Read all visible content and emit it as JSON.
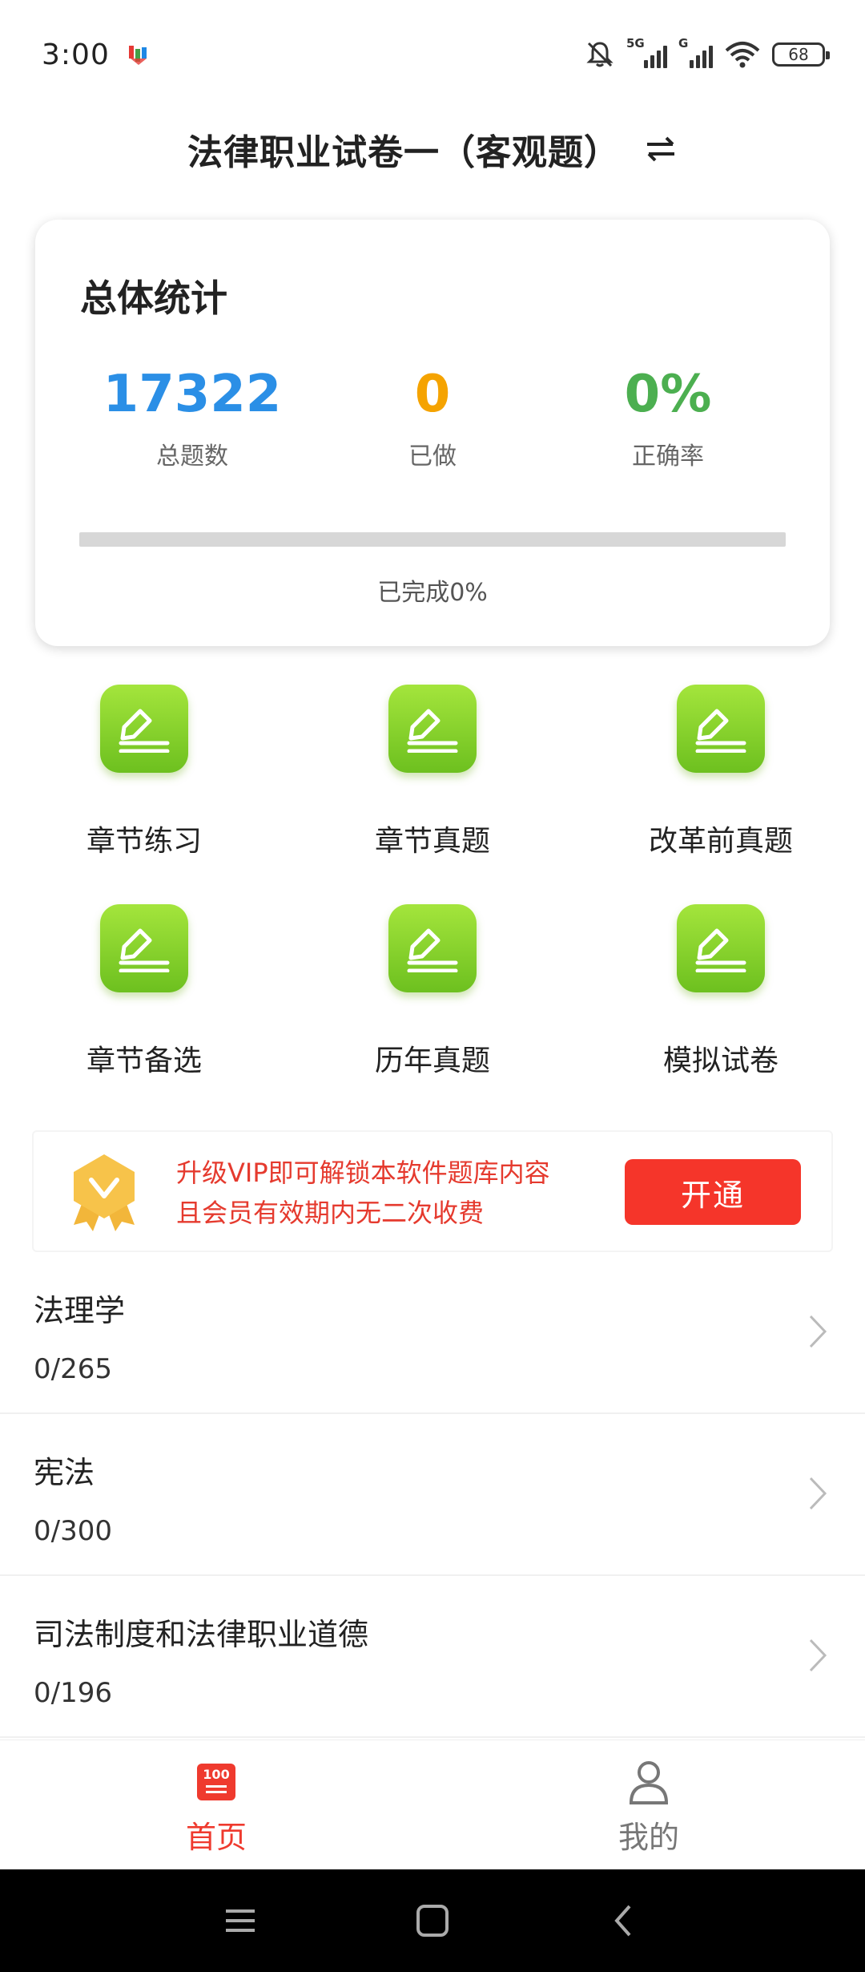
{
  "status_bar": {
    "time": "3:00",
    "signal_1_tag": "5G",
    "signal_2_tag": "G",
    "battery": "68"
  },
  "header": {
    "title": "法律职业试卷一（客观题）",
    "swap_icon": "swap-arrows-icon"
  },
  "stats": {
    "title": "总体统计",
    "total_value": "17322",
    "total_label": "总题数",
    "done_value": "0",
    "done_label": "已做",
    "accuracy_value": "0%",
    "accuracy_label": "正确率",
    "progress_fraction": 0,
    "progress_text": "已完成0%",
    "colors": {
      "total": "#2b8fe6",
      "done": "#f5a300",
      "accuracy": "#4caf50"
    }
  },
  "grid": [
    {
      "label": "章节练习",
      "icon": "edit-icon"
    },
    {
      "label": "章节真题",
      "icon": "edit-icon"
    },
    {
      "label": "改革前真题",
      "icon": "edit-icon"
    },
    {
      "label": "章节备选",
      "icon": "edit-icon"
    },
    {
      "label": "历年真题",
      "icon": "edit-icon"
    },
    {
      "label": "模拟试卷",
      "icon": "edit-icon"
    }
  ],
  "vip": {
    "line1": "升级VIP即可解锁本软件题库内容",
    "line2": "且会员有效期内无二次收费",
    "button": "开通",
    "badge_icon": "vip-badge-icon"
  },
  "chapters": [
    {
      "title": "法理学",
      "progress": "0/265"
    },
    {
      "title": "宪法",
      "progress": "0/300"
    },
    {
      "title": "司法制度和法律职业道德",
      "progress": "0/196"
    }
  ],
  "bottom_nav": {
    "home_label": "首页",
    "home_icon_text": "100",
    "mine_label": "我的",
    "active_color": "#ef3a2e",
    "inactive_color": "#777777"
  }
}
